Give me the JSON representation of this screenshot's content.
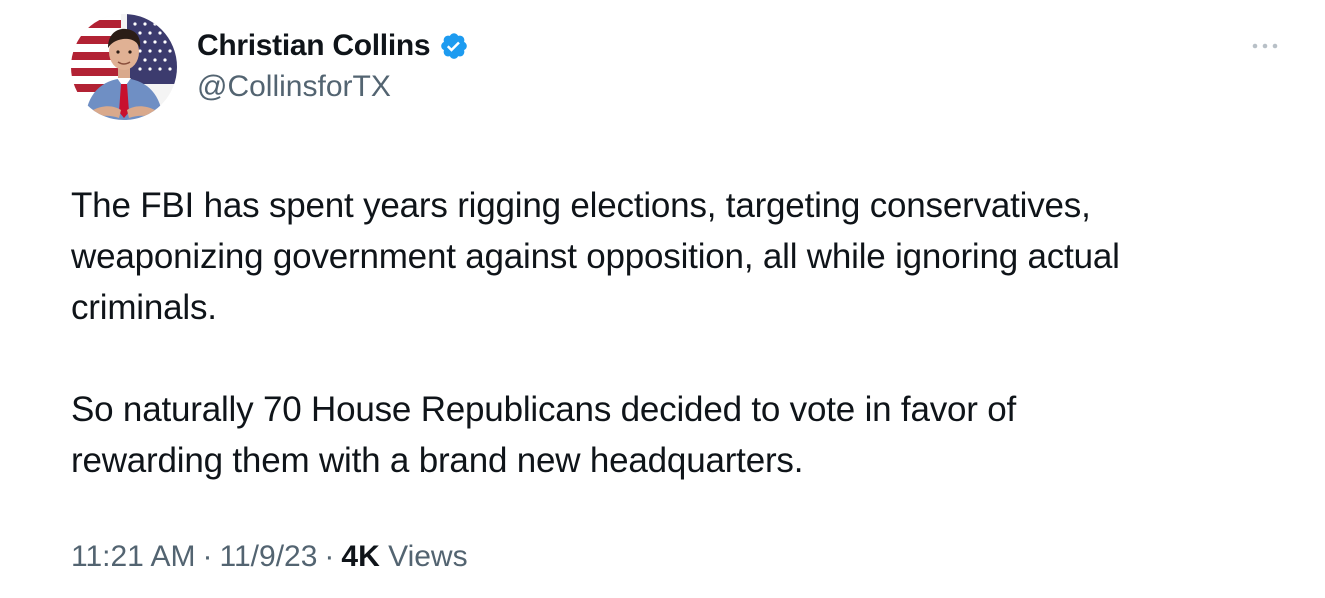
{
  "author": {
    "display_name": "Christian Collins",
    "handle": "@CollinsforTX",
    "verified": true,
    "verified_icon": "verified-badge-icon",
    "verified_color": "#1d9bf0"
  },
  "menu": {
    "icon": "more-options-icon"
  },
  "tweet": {
    "paragraphs": [
      "The FBI has spent years rigging elections, targeting conservatives,\nweaponizing government against opposition, all while ignoring actual\ncriminals.",
      "So naturally 70 House Republicans decided to vote in favor of\nrewarding them with a brand new headquarters."
    ]
  },
  "meta": {
    "time": "11:21 AM",
    "separator": "·",
    "date": "11/9/23",
    "views_count": "4K",
    "views_label": "Views"
  },
  "colors": {
    "text_primary": "#0f1419",
    "text_secondary": "#536471",
    "background": "#ffffff"
  }
}
